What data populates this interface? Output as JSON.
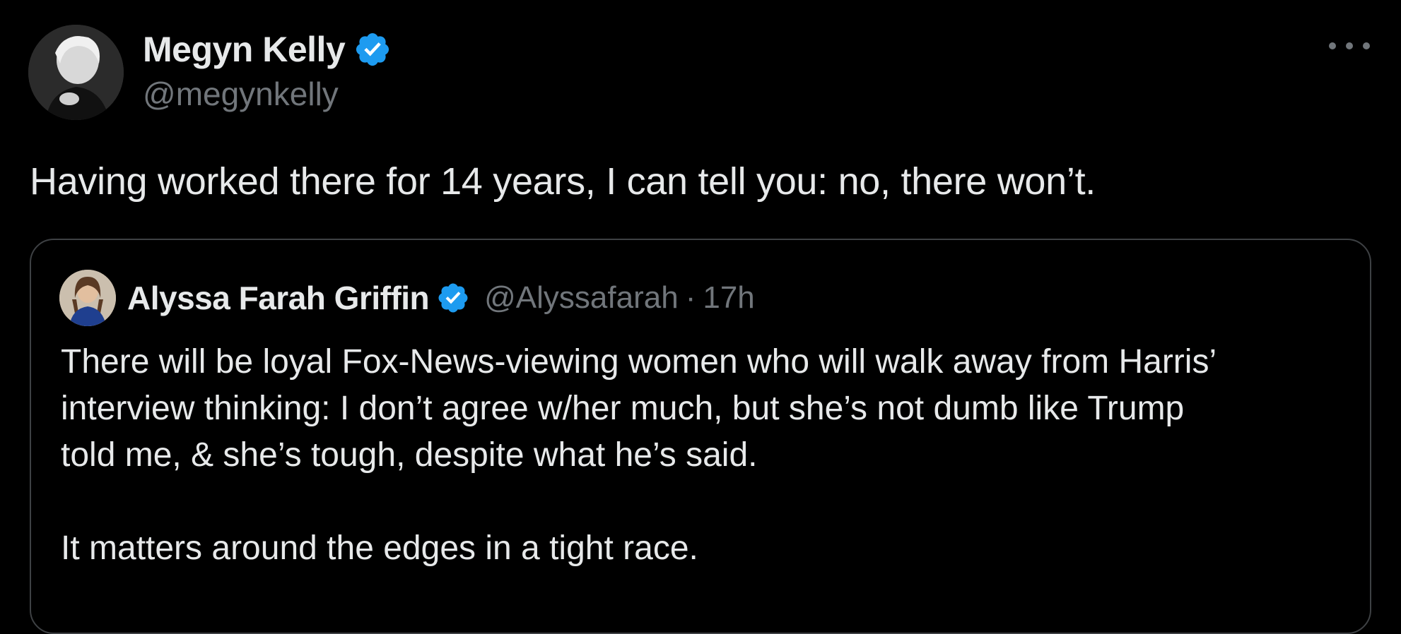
{
  "tweet": {
    "author": {
      "display_name": "Megyn Kelly",
      "handle": "@megynkelly",
      "verified": true
    },
    "text": "Having worked there for 14 years, I can tell you: no, there won’t.",
    "more_icon": "more-horizontal-icon"
  },
  "quoted_tweet": {
    "author": {
      "display_name": "Alyssa Farah Griffin",
      "handle": "@Alyssafarah",
      "verified": true
    },
    "separator": "·",
    "time": "17h",
    "text": "There will be loyal Fox-News-viewing women who will walk away from Harris’\ninterview thinking: I don’t agree w/her much, but she’s not dumb like Trump\ntold me, & she’s tough, despite what he’s said.\n\nIt matters around the edges in a tight race."
  },
  "colors": {
    "background": "#000000",
    "primary_text": "#e7e9ea",
    "secondary_text": "#71767b",
    "verified_badge": "#1d9bf0",
    "border": "#3e4144"
  }
}
